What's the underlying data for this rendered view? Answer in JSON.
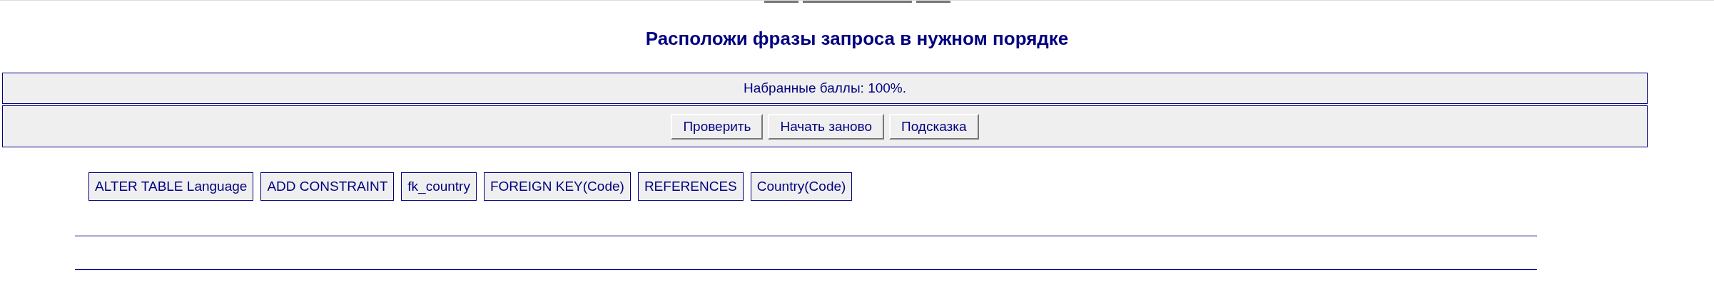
{
  "title": "Расположи фразы запроса в нужном порядке",
  "score": "Набранные баллы: 100%.",
  "buttons": [
    "Проверить",
    "Начать заново",
    "Подсказка"
  ],
  "phrases": [
    "ALTER TABLE Language",
    "ADD CONSTRAINT",
    "fk_country",
    "FOREIGN KEY(Code)",
    "REFERENCES",
    "Country(Code)"
  ]
}
